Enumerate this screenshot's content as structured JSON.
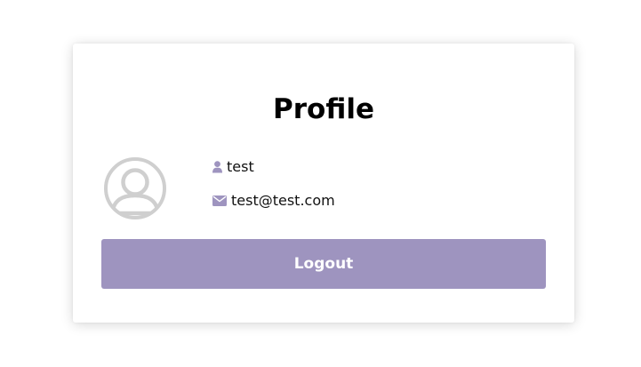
{
  "profile": {
    "title": "Profile",
    "username": "test",
    "email": "test@test.com",
    "logout_label": "Logout"
  },
  "icons": {
    "avatar": "user-avatar-icon",
    "user": "user-icon",
    "email": "envelope-icon"
  },
  "colors": {
    "accent": "#9e94bf",
    "avatar_gray": "#cfcfcf",
    "text": "#111111",
    "background": "#ffffff"
  }
}
